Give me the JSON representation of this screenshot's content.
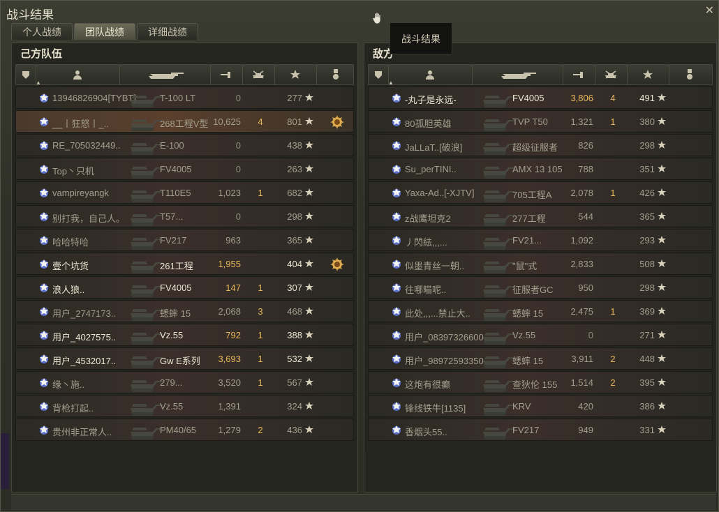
{
  "window": {
    "title": "战斗结果"
  },
  "tabs": [
    {
      "label": "个人战绩",
      "active": false
    },
    {
      "label": "团队战绩",
      "active": true
    },
    {
      "label": "详细战绩",
      "active": false
    }
  ],
  "tooltip": "战斗结果",
  "left_team": {
    "title": "己方队伍",
    "players": [
      {
        "name": "13946826904[TYBT]",
        "tank": "T-100 LT",
        "damage": "0",
        "kills": "",
        "xp": "277",
        "alive": false,
        "self": false
      },
      {
        "name": "__丨狂怒丨_..",
        "tank": "268工程V型",
        "damage": "10,625",
        "kills": "4",
        "xp": "801",
        "alive": false,
        "self": true,
        "award": true
      },
      {
        "name": "RE_705032449..",
        "tank": "E-100",
        "damage": "0",
        "kills": "",
        "xp": "438",
        "alive": false,
        "self": false
      },
      {
        "name": "Top丶只机",
        "tank": "FV4005",
        "damage": "0",
        "kills": "",
        "xp": "263",
        "alive": false,
        "self": false
      },
      {
        "name": "vampireyangk",
        "tank": "T110E5",
        "damage": "1,023",
        "kills": "1",
        "xp": "682",
        "alive": false,
        "self": false
      },
      {
        "name": "别打我，自己人。",
        "tank": "T57...",
        "damage": "0",
        "kills": "",
        "xp": "298",
        "alive": false,
        "self": false
      },
      {
        "name": "哈哈特哈",
        "tank": "FV217",
        "damage": "963",
        "kills": "",
        "xp": "365",
        "alive": false,
        "self": false
      },
      {
        "name": "壹个坑货",
        "tank": "261工程",
        "damage": "1,955",
        "kills": "",
        "xp": "404",
        "alive": true,
        "self": false,
        "award": true
      },
      {
        "name": "浪人狼..",
        "tank": "FV4005",
        "damage": "147",
        "kills": "1",
        "xp": "307",
        "alive": true,
        "self": false
      },
      {
        "name": "用户_2747173..",
        "tank": "蟋蟀 15",
        "damage": "2,068",
        "kills": "3",
        "xp": "468",
        "alive": false,
        "self": false
      },
      {
        "name": "用户_4027575..",
        "tank": "Vz.55",
        "damage": "792",
        "kills": "1",
        "xp": "388",
        "alive": true,
        "self": false
      },
      {
        "name": "用户_4532017..",
        "tank": "Gw E系列",
        "damage": "3,693",
        "kills": "1",
        "xp": "532",
        "alive": true,
        "self": false
      },
      {
        "name": "缘丶施..",
        "tank": "279...",
        "damage": "3,520",
        "kills": "1",
        "xp": "567",
        "alive": false,
        "self": false
      },
      {
        "name": "背枪打起..",
        "tank": "Vz.55",
        "damage": "1,391",
        "kills": "",
        "xp": "324",
        "alive": false,
        "self": false
      },
      {
        "name": "贵州非正常人..",
        "tank": "PM40/65",
        "damage": "1,279",
        "kills": "2",
        "xp": "436",
        "alive": false,
        "self": false
      }
    ]
  },
  "right_team": {
    "title": "敌方",
    "players": [
      {
        "name": "-丸子是永远-",
        "tank": "FV4005",
        "damage": "3,806",
        "kills": "4",
        "xp": "491",
        "alive": true,
        "self": false
      },
      {
        "name": "80孤胆英雄",
        "tank": "TVP T50",
        "damage": "1,321",
        "kills": "1",
        "xp": "380",
        "alive": false,
        "self": false
      },
      {
        "name": "JaLLaT..[破浪]",
        "tank": "超级征服者",
        "damage": "826",
        "kills": "",
        "xp": "298",
        "alive": false,
        "self": false
      },
      {
        "name": "Su_perTINI..",
        "tank": "AMX 13 105",
        "damage": "788",
        "kills": "",
        "xp": "351",
        "alive": false,
        "self": false
      },
      {
        "name": "Yaxa-Ad..[-XJTV]",
        "tank": "705工程A",
        "damage": "2,078",
        "kills": "1",
        "xp": "426",
        "alive": false,
        "self": false
      },
      {
        "name": "z战鹰坦克2",
        "tank": "277工程",
        "damage": "544",
        "kills": "",
        "xp": "365",
        "alive": false,
        "self": false
      },
      {
        "name": "丿閃紶,,,...",
        "tank": "FV21...",
        "damage": "1,092",
        "kills": "",
        "xp": "293",
        "alive": false,
        "self": false
      },
      {
        "name": "似墨青丝一朝..",
        "tank": "\"鼠\"式",
        "damage": "2,833",
        "kills": "",
        "xp": "508",
        "alive": false,
        "self": false
      },
      {
        "name": "往哪瞄呢..",
        "tank": "征服者GC",
        "damage": "950",
        "kills": "",
        "xp": "298",
        "alive": false,
        "self": false
      },
      {
        "name": "此处,,,...禁止大..",
        "tank": "蟋蟀 15",
        "damage": "2,475",
        "kills": "1",
        "xp": "369",
        "alive": false,
        "self": false
      },
      {
        "name": "用户_08397326600",
        "tank": "Vz.55",
        "damage": "0",
        "kills": "",
        "xp": "271",
        "alive": false,
        "self": false
      },
      {
        "name": "用户_98972593350",
        "tank": "蟋蟀 15",
        "damage": "3,911",
        "kills": "2",
        "xp": "448",
        "alive": false,
        "self": false
      },
      {
        "name": "这炮有很癫",
        "tank": "查狄伦 155",
        "damage": "1,514",
        "kills": "2",
        "xp": "395",
        "alive": false,
        "self": false
      },
      {
        "name": "锋线铁牛[1135]",
        "tank": "KRV",
        "damage": "420",
        "kills": "",
        "xp": "386",
        "alive": false,
        "self": false
      },
      {
        "name": "香烟头55..",
        "tank": "FV217",
        "damage": "949",
        "kills": "",
        "xp": "331",
        "alive": false,
        "self": false
      }
    ]
  },
  "icons": {
    "close": "close-icon",
    "hand": "hand-cursor-icon",
    "star": "star-icon",
    "award": "mastery-award-icon",
    "tank": "tank-silhouette-icon"
  },
  "colors": {
    "accent_gold": "#e8b85c",
    "self_row": "#5a3f2c"
  }
}
